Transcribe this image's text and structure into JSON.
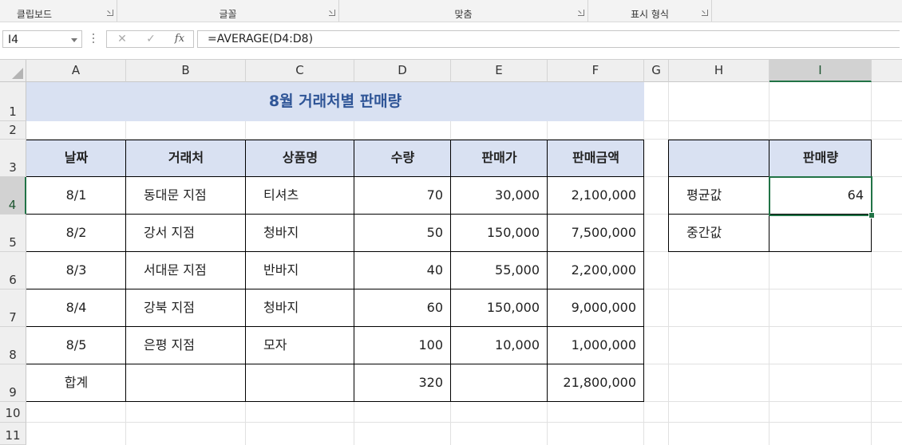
{
  "ribbon": {
    "groups": [
      "클립보드",
      "글꼴",
      "맞춤",
      "표시 형식"
    ]
  },
  "formula_bar": {
    "name_box": "I4",
    "cancel_icon": "✕",
    "enter_icon": "✓",
    "fx_label": "fx",
    "formula": "=AVERAGE(D4:D8)"
  },
  "columns": [
    "A",
    "B",
    "C",
    "D",
    "E",
    "F",
    "G",
    "H",
    "I"
  ],
  "rows": [
    "1",
    "2",
    "3",
    "4",
    "5",
    "6",
    "7",
    "8",
    "9",
    "10",
    "11"
  ],
  "selected_cell": {
    "column": "I",
    "row": "4"
  },
  "sheet": {
    "title": "8월 거래처별 판매량",
    "table_headers": [
      "날짜",
      "거래처",
      "상품명",
      "수량",
      "판매가",
      "판매금액"
    ],
    "table_rows": [
      [
        "8/1",
        "동대문 지점",
        "티셔츠",
        "70",
        "30,000",
        "2,100,000"
      ],
      [
        "8/2",
        "강서 지점",
        "청바지",
        "50",
        "150,000",
        "7,500,000"
      ],
      [
        "8/3",
        "서대문 지점",
        "반바지",
        "40",
        "55,000",
        "2,200,000"
      ],
      [
        "8/4",
        "강북 지점",
        "청바지",
        "60",
        "150,000",
        "9,000,000"
      ],
      [
        "8/5",
        "은평 지점",
        "모자",
        "100",
        "10,000",
        "1,000,000"
      ]
    ],
    "total_row": [
      "합계",
      "",
      "",
      "320",
      "",
      "21,800,000"
    ],
    "summary": {
      "header": "판매량",
      "rows": [
        {
          "label": "평균값",
          "value": "64"
        },
        {
          "label": "중간값",
          "value": ""
        }
      ]
    }
  }
}
